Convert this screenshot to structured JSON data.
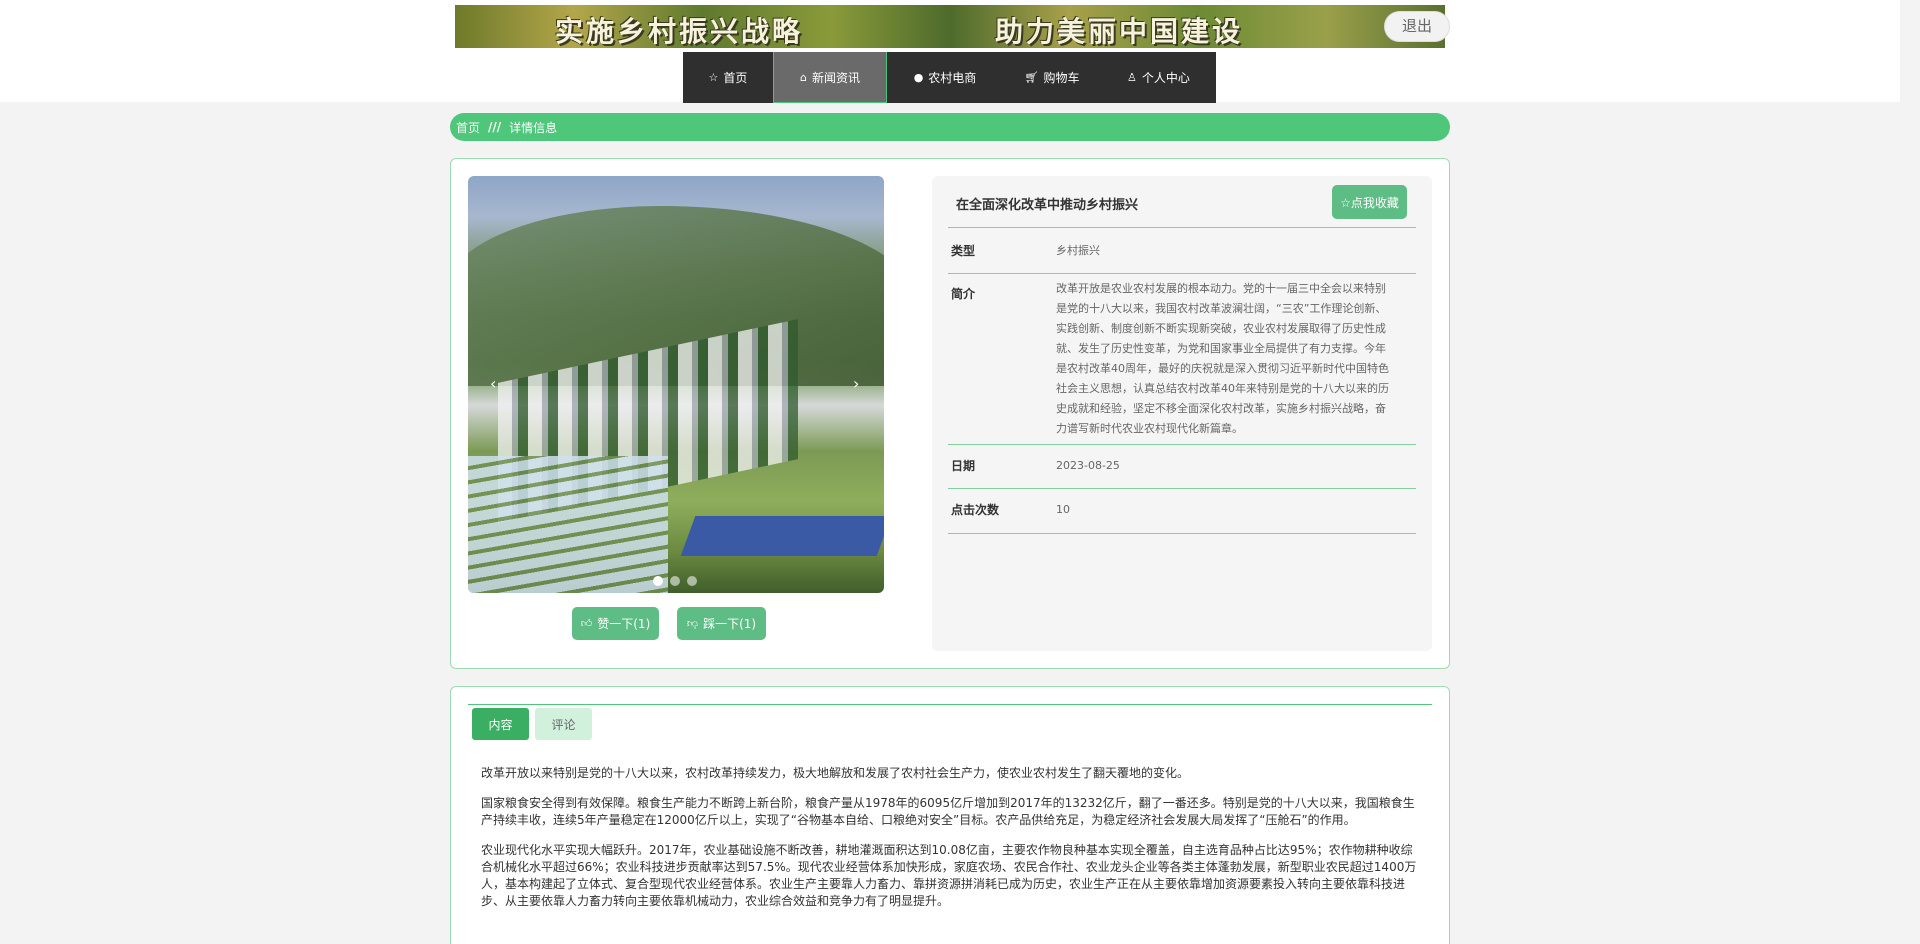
{
  "banner": {
    "left_text": "实施乡村振兴战略",
    "right_text": "助力美丽中国建设",
    "logout_label": "退出"
  },
  "nav": {
    "items": [
      {
        "label": "首页",
        "icon": "star-icon"
      },
      {
        "label": "新闻资讯",
        "icon": "home-icon"
      },
      {
        "label": "农村电商",
        "icon": "info-circle-icon"
      },
      {
        "label": "购物车",
        "icon": "cart-icon"
      },
      {
        "label": "个人中心",
        "icon": "user-icon"
      }
    ],
    "active_index": 1
  },
  "breadcrumb": {
    "home": "首页",
    "separator": "///",
    "current": "详情信息"
  },
  "detail": {
    "title": "在全面深化改革中推动乡村振兴",
    "favorite_label": "☆点我收藏",
    "like_label": "赞一下(1)",
    "dislike_label": "踩一下(1)",
    "type_label": "类型",
    "type_value": "乡村振兴",
    "intro_label": "简介",
    "intro_value": "改革开放是农业农村发展的根本动力。党的十一届三中全会以来特别是党的十八大以来，我国农村改革波澜壮阔，“三农”工作理论创新、实践创新、制度创新不断实现新突破，农业农村发展取得了历史性成就、发生了历史性变革，为党和国家事业全局提供了有力支撑。今年是农村改革40周年，最好的庆祝就是深入贯彻习近平新时代中国特色社会主义思想，认真总结农村改革40年来特别是党的十八大以来的历史成就和经验，坚定不移全面深化农村改革，实施乡村振兴战略，奋力谱写新时代农业农村现代化新篇章。",
    "date_label": "日期",
    "date_value": "2023-08-25",
    "clicks_label": "点击次数",
    "clicks_value": "10"
  },
  "carousel": {
    "prev_glyph": "‹",
    "next_glyph": "›",
    "slide_count": 3,
    "active_slide": 0
  },
  "content": {
    "tab_content": "内容",
    "tab_comments": "评论",
    "paragraphs": [
      "改革开放以来特别是党的十八大以来，农村改革持续发力，极大地解放和发展了农村社会生产力，使农业农村发生了翻天覆地的变化。",
      "国家粮食安全得到有效保障。粮食生产能力不断跨上新台阶，粮食产量从1978年的6095亿斤增加到2017年的13232亿斤，翻了一番还多。特别是党的十八大以来，我国粮食生产持续丰收，连续5年产量稳定在12000亿斤以上，实现了“谷物基本自给、口粮绝对安全”目标。农产品供给充足，为稳定经济社会发展大局发挥了“压舱石”的作用。",
      "农业现代化水平实现大幅跃升。2017年，农业基础设施不断改善，耕地灌溉面积达到10.08亿亩，主要农作物良种基本实现全覆盖，自主选育品种占比达95%；农作物耕种收综合机械化水平超过66%；农业科技进步贡献率达到57.5%。现代农业经营体系加快形成，家庭农场、农民合作社、农业龙头企业等各类主体蓬勃发展，新型职业农民超过1400万人，基本构建起了立体式、复合型现代农业经营体系。农业生产主要靠人力畜力、靠拼资源拼消耗已成为历史，农业生产正在从主要依靠增加资源要素投入转向主要依靠科技进步、从主要依靠人力畜力转向主要依靠机械动力，农业综合效益和竞争力有了明显提升。"
    ]
  },
  "colors": {
    "accent_green": "#4ec77a",
    "button_green": "#5ebd85",
    "nav_bg": "#2f2f2f"
  }
}
